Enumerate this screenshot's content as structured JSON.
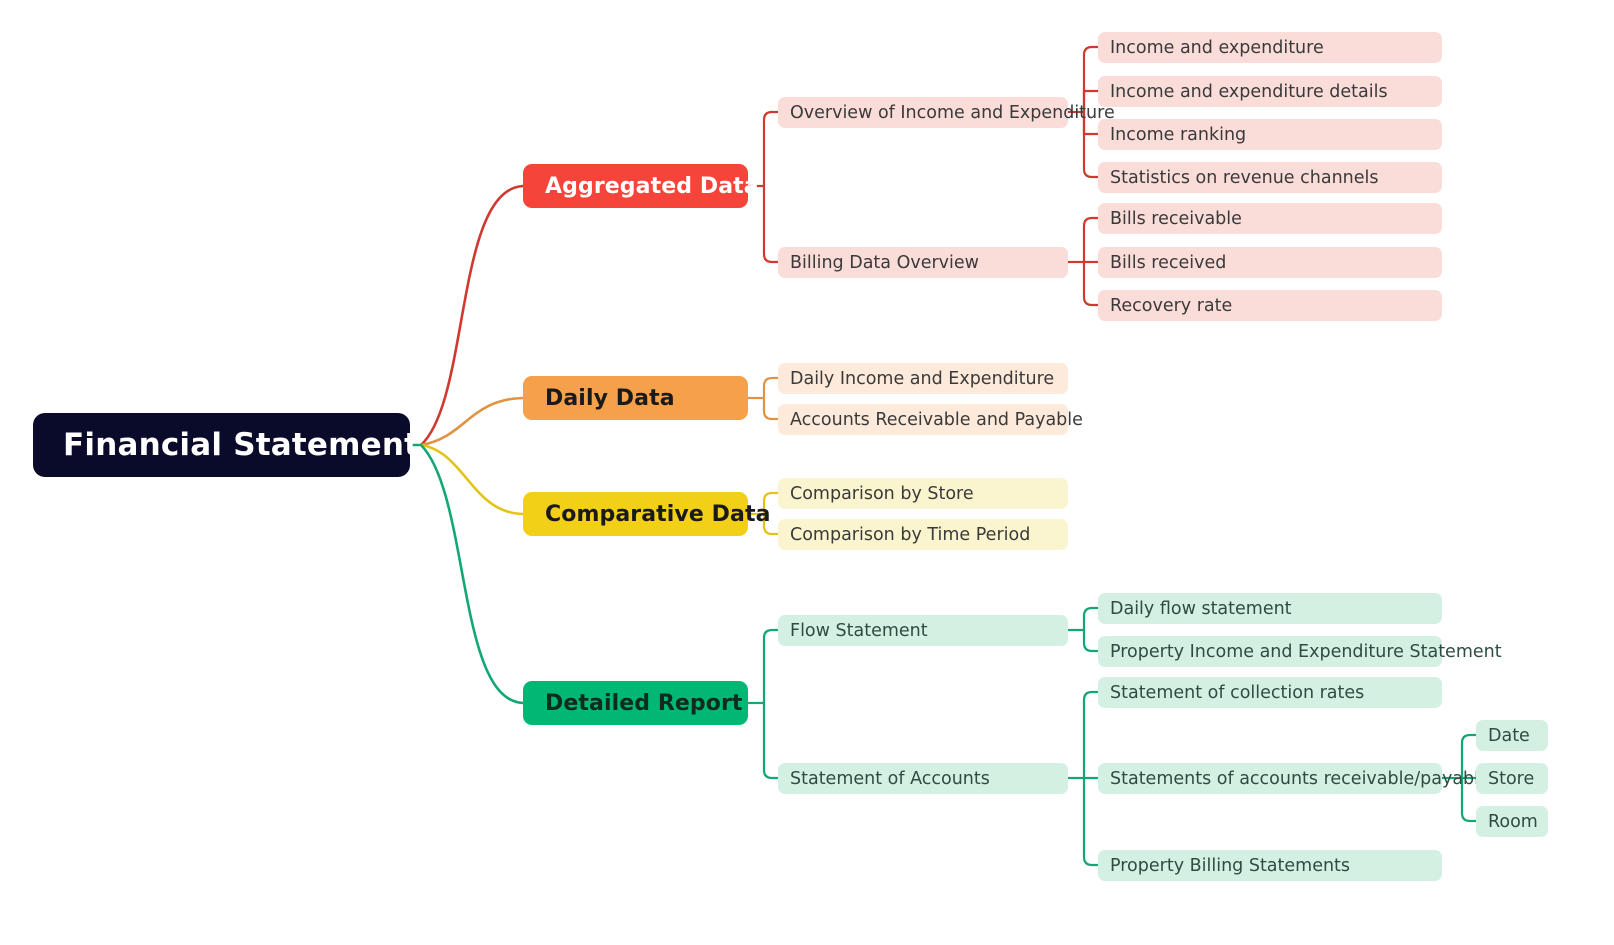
{
  "diagram": {
    "type": "mindmap",
    "title": "Financial Statement",
    "background": "#ffffff",
    "root": {
      "label": "Financial Statement",
      "fill": "#0a0a2a",
      "text_color": "#ffffff"
    },
    "branch_colors": {
      "aggregated": "#f5453b",
      "daily": "#f5a04a",
      "comparative": "#f2d017",
      "detailed": "#00b874"
    },
    "branches": [
      {
        "id": "aggregated",
        "label": "Aggregated Data",
        "fill": "#f5453b",
        "text_color": "#ffffff",
        "line_color": "#d0392f",
        "child_fill": "#fadcd9",
        "child_text": "#3a3a3a",
        "children": [
          {
            "label": "Overview of Income and Expenditure",
            "children": [
              {
                "label": "Income and expenditure"
              },
              {
                "label": "Income and expenditure details"
              },
              {
                "label": "Income ranking"
              },
              {
                "label": "Statistics on revenue channels"
              }
            ]
          },
          {
            "label": "Billing Data Overview",
            "children": [
              {
                "label": "Bills receivable"
              },
              {
                "label": "Bills received"
              },
              {
                "label": "Recovery rate"
              }
            ]
          }
        ]
      },
      {
        "id": "daily",
        "label": "Daily Data",
        "fill": "#f5a04a",
        "text_color": "#1a1a1a",
        "line_color": "#e09343",
        "child_fill": "#fdeadb",
        "child_text": "#3a3a3a",
        "children": [
          {
            "label": "Daily Income and Expenditure",
            "children": []
          },
          {
            "label": "Accounts Receivable and Payable",
            "children": []
          }
        ]
      },
      {
        "id": "comparative",
        "label": "Comparative Data",
        "fill": "#f2d017",
        "text_color": "#1a1a1a",
        "line_color": "#e3c316",
        "child_fill": "#fbf5cf",
        "child_text": "#3a3a3a",
        "children": [
          {
            "label": "Comparison by Store",
            "children": []
          },
          {
            "label": "Comparison by Time Period",
            "children": []
          }
        ]
      },
      {
        "id": "detailed",
        "label": "Detailed Report",
        "fill": "#00b874",
        "text_color": "#0e2b20",
        "line_color": "#13a873",
        "child_fill": "#d4f0e3",
        "child_text": "#2d4c42",
        "children": [
          {
            "label": "Flow Statement",
            "children": [
              {
                "label": "Daily flow statement"
              },
              {
                "label": "Property Income and Expenditure Statement"
              }
            ]
          },
          {
            "label": "Statement of Accounts",
            "children": [
              {
                "label": "Statement of collection rates"
              },
              {
                "label": "Statements of accounts receivable/payable",
                "children": [
                  {
                    "label": "Date"
                  },
                  {
                    "label": "Store"
                  },
                  {
                    "label": "Room"
                  }
                ]
              },
              {
                "label": "Property Billing Statements"
              }
            ]
          }
        ]
      }
    ]
  }
}
